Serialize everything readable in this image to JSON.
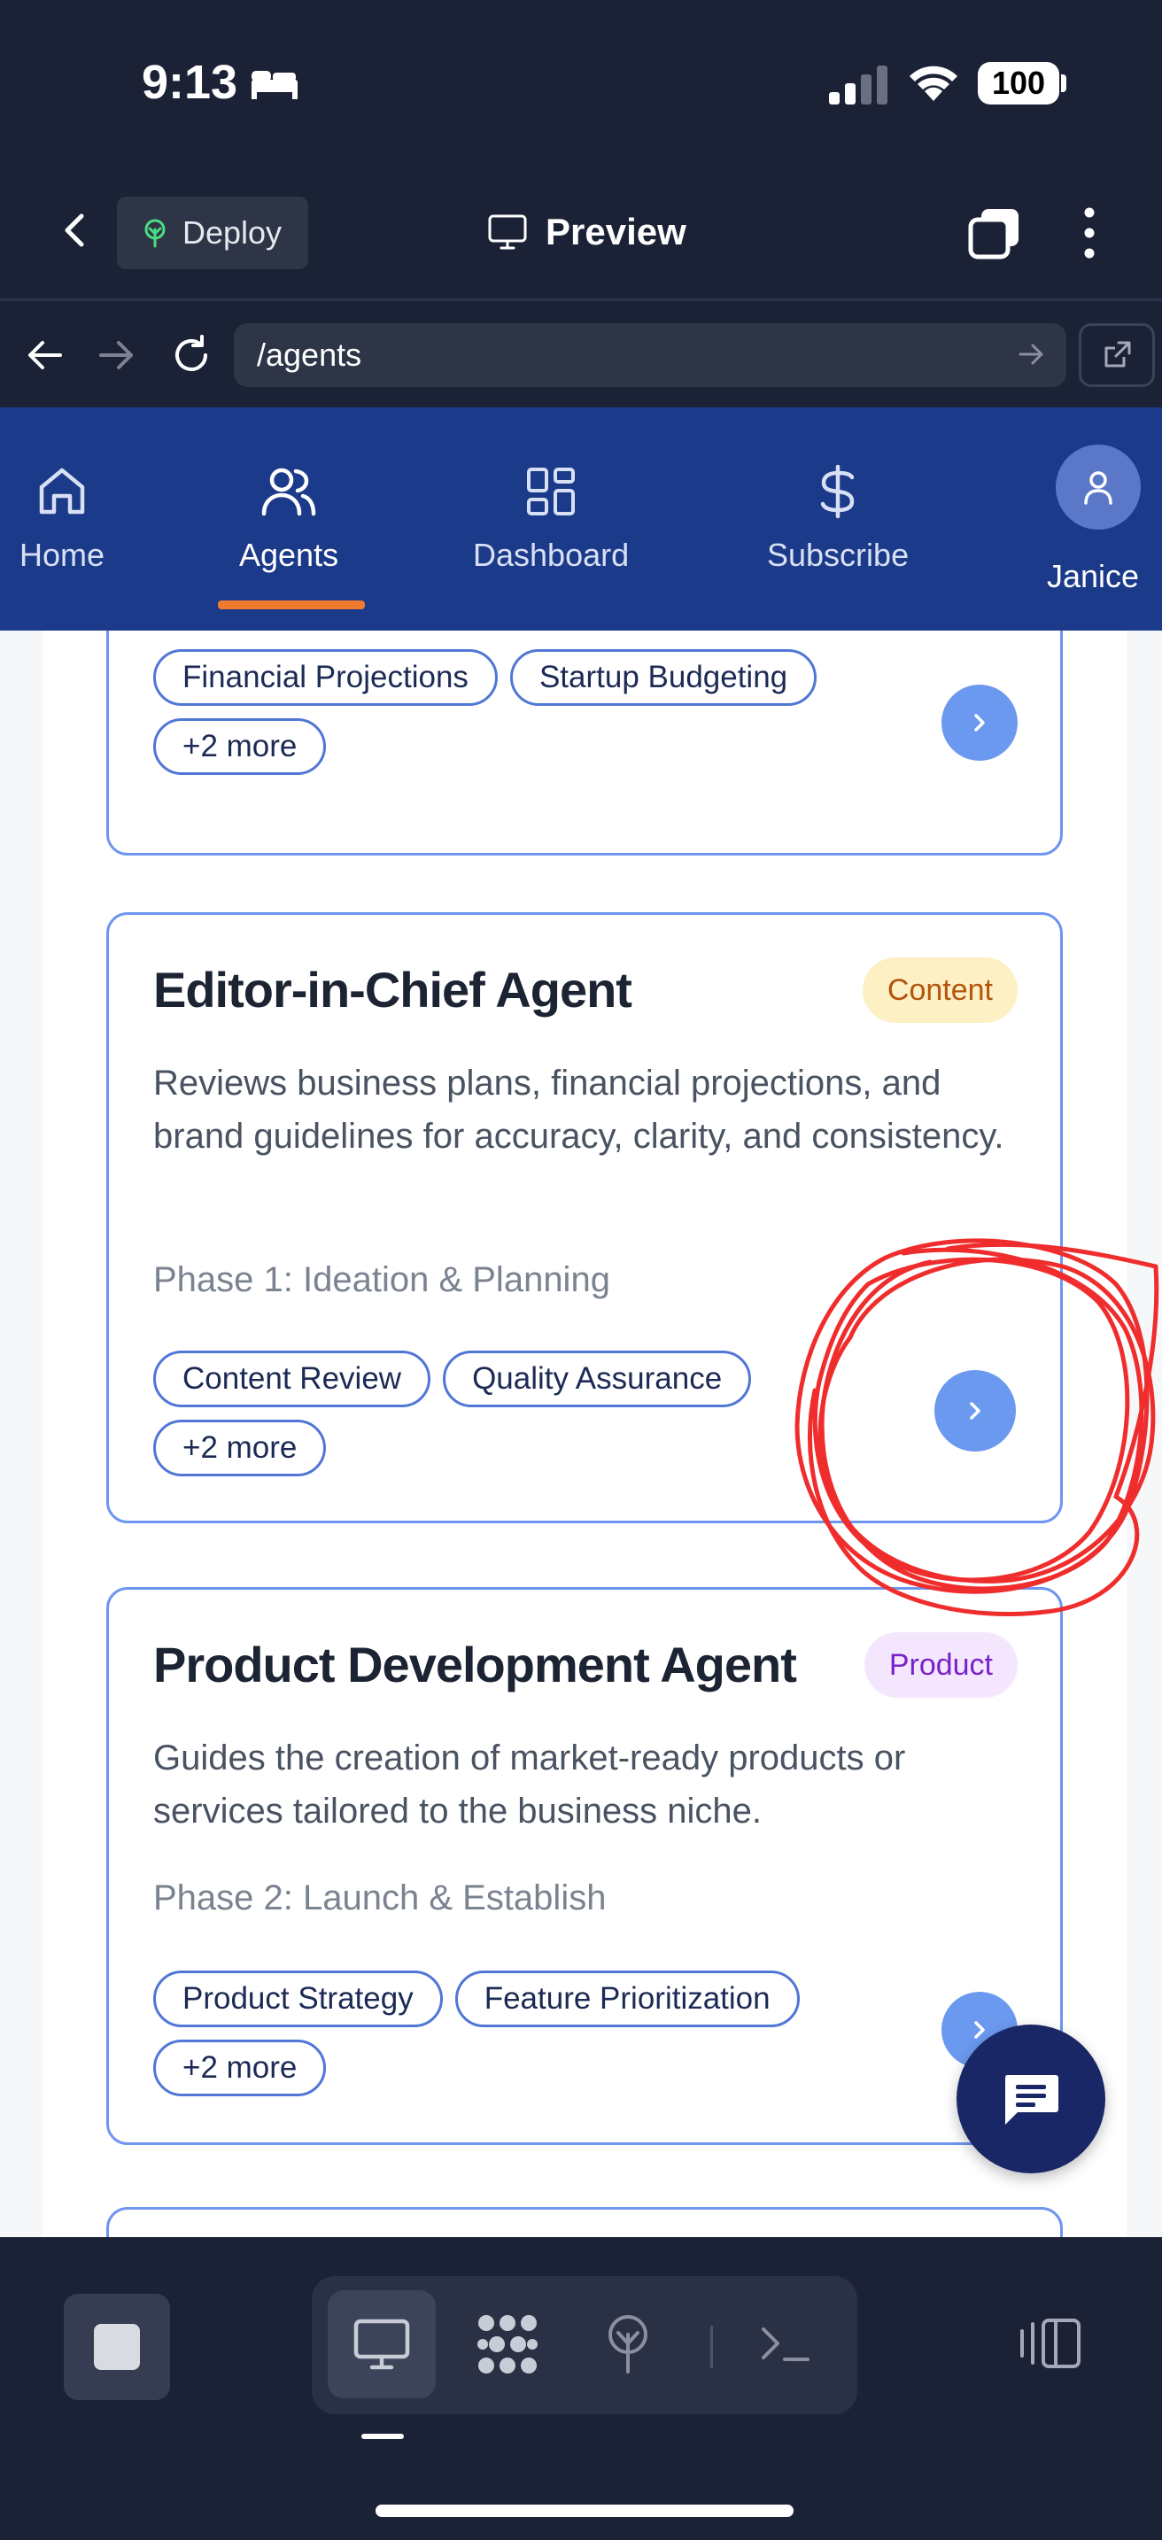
{
  "status_bar": {
    "time": "9:13",
    "battery": "100"
  },
  "header": {
    "deploy_label": "Deploy",
    "title": "Preview"
  },
  "browser": {
    "url": "/agents"
  },
  "nav": {
    "items": [
      {
        "label": "Home",
        "icon": "home-icon"
      },
      {
        "label": "Agents",
        "icon": "users-icon",
        "active": true
      },
      {
        "label": "Dashboard",
        "icon": "grid-icon"
      },
      {
        "label": "Subscribe",
        "icon": "dollar-icon"
      }
    ],
    "user_name": "Janice"
  },
  "cards": [
    {
      "tags": [
        "Financial Projections",
        "Startup Budgeting",
        "+2 more"
      ]
    },
    {
      "title": "Editor-in-Chief Agent",
      "badge": "Content",
      "description": "Reviews business plans, financial projections, and brand guidelines for accuracy, clarity, and consistency.",
      "phase": "Phase 1: Ideation & Planning",
      "tags": [
        "Content Review",
        "Quality Assurance",
        "+2 more"
      ]
    },
    {
      "title": "Product Development Agent",
      "badge": "Product",
      "description": "Guides the creation of market-ready products or services tailored to the business niche.",
      "phase": "Phase 2: Launch & Establish",
      "tags": [
        "Product Strategy",
        "Feature Prioritization",
        "+2 more"
      ]
    }
  ],
  "colors": {
    "accent": "#1b3a8a",
    "active_tab": "#f07a2f",
    "card_border": "#6e95f0",
    "annotation": "#f02d2d"
  }
}
